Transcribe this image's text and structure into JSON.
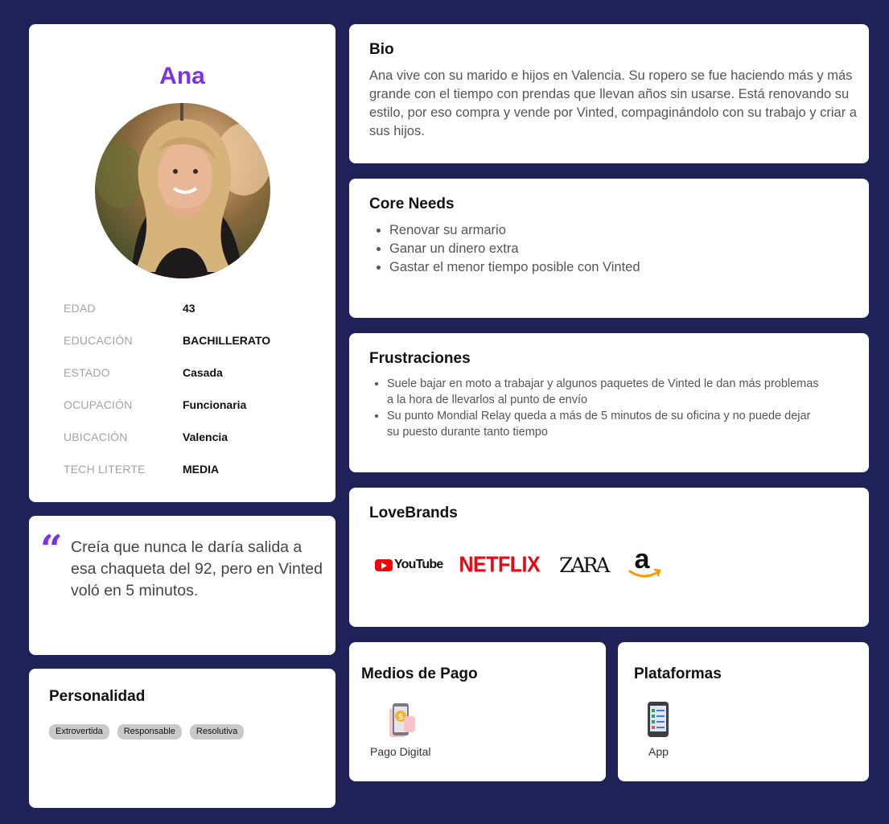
{
  "profile": {
    "name": "Ana",
    "facts": [
      {
        "label": "EDAD",
        "value": "43"
      },
      {
        "label": "EDUCACIÓN",
        "value": "BACHILLERATO"
      },
      {
        "label": "ESTADO",
        "value": "Casada"
      },
      {
        "label": "OCUPACIÓN",
        "value": "Funcionaria"
      },
      {
        "label": "UBICACIÓN",
        "value": "Valencia"
      },
      {
        "label": "TECH LITERTE",
        "value": "MEDIA"
      }
    ]
  },
  "quote": {
    "mark": "“",
    "text": "Creía que nunca le daría salida a esa chaqueta del 92, pero en Vinted voló en 5 minutos."
  },
  "personality": {
    "title": "Personalidad",
    "tags": [
      "Extrovertida",
      "Responsable",
      "Resolutiva"
    ]
  },
  "bio": {
    "title": "Bio",
    "text": "Ana vive con su marido e hijos en Valencia. Su ropero se fue haciendo más y más grande con el tiempo con prendas que llevan años sin usarse. Está renovando su estilo, por eso compra y vende por Vinted, compaginándolo con su trabajo y criar a sus hijos."
  },
  "core_needs": {
    "title": "Core Needs",
    "items": [
      "Renovar su armario",
      "Ganar un dinero extra",
      "Gastar el menor tiempo posible con Vinted"
    ]
  },
  "frustrations": {
    "title": "Frustraciones",
    "items": [
      "Suele bajar en moto a trabajar y algunos paquetes de Vinted le dan más problemas a la hora de llevarlos al punto de envío",
      "Su punto Mondial Relay queda a más de 5 minutos de su oficina y no puede dejar su puesto durante tanto tiempo"
    ]
  },
  "lovebrands": {
    "title": "LoveBrands",
    "youtube": "YouTube",
    "netflix": "NETFLIX",
    "zara": "ZARA",
    "amazon": "a"
  },
  "payment": {
    "title": "Medios de Pago",
    "item_label": "Pago Digital",
    "icon": "mobile-payment-icon"
  },
  "platforms": {
    "title": "Plataformas",
    "item_label": "App",
    "icon": "smartphone-app-icon"
  },
  "colors": {
    "background": "#1e2258",
    "accent": "#7b33e8",
    "card": "#ffffff"
  }
}
